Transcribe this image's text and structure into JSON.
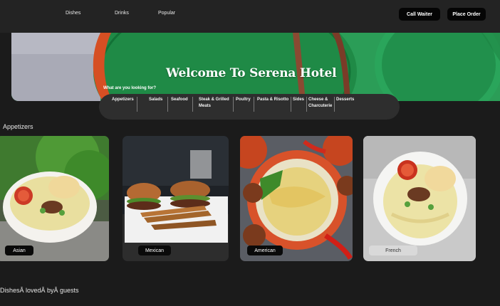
{
  "nav": {
    "links": [
      "Dishes",
      "Drinks",
      "Popular"
    ],
    "call_waiter": "Call Waiter",
    "place_order": "Place Order"
  },
  "hero": {
    "title": "Welcome To Serena Hotel",
    "search_label": "What are you looking for?"
  },
  "categories": [
    "Appetizers",
    "Salads",
    "Seafood",
    "Steak & Grilled Meats",
    "Poultry",
    "Pasta & Risotto",
    "Sides",
    "Cheese & Charcuterie",
    "Desserts"
  ],
  "sections": {
    "appetizers_title": "Appetizers",
    "loved_title": "DishesÂ lovedÂ byÂ guests"
  },
  "cards": [
    {
      "label": "Asian"
    },
    {
      "label": "Mexican"
    },
    {
      "label": "American"
    },
    {
      "label": "French"
    }
  ],
  "colors": {
    "background": "#1b1b1b",
    "topbar": "#232323",
    "button": "#050505",
    "pill_bar": "#2e2e2e",
    "hero_green": "#2a9a55"
  }
}
